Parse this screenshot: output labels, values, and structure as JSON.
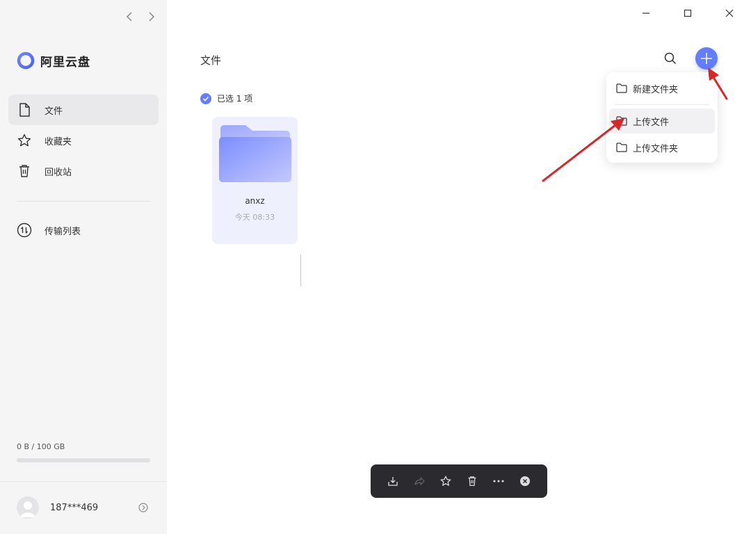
{
  "app": {
    "name": "阿里云盘"
  },
  "sidebar": {
    "items": [
      {
        "label": "文件",
        "icon": "file-icon",
        "active": true
      },
      {
        "label": "收藏夹",
        "icon": "star-icon",
        "active": false
      },
      {
        "label": "回收站",
        "icon": "trash-icon",
        "active": false
      }
    ],
    "transfer_label": "传输列表",
    "storage": {
      "text": "0 B / 100 GB",
      "used_fraction": 0.0
    },
    "user": {
      "name": "187***469"
    }
  },
  "main": {
    "title": "文件",
    "selection_text": "已选 1 项",
    "files": [
      {
        "name": "anxz",
        "time": "今天 08:33",
        "type": "folder",
        "selected": true
      }
    ]
  },
  "dropdown": {
    "items": [
      {
        "label": "新建文件夹"
      },
      {
        "label": "上传文件"
      },
      {
        "label": "上传文件夹"
      }
    ]
  },
  "colors": {
    "accent": "#637dff",
    "annotation_arrow": "#d9262b"
  }
}
